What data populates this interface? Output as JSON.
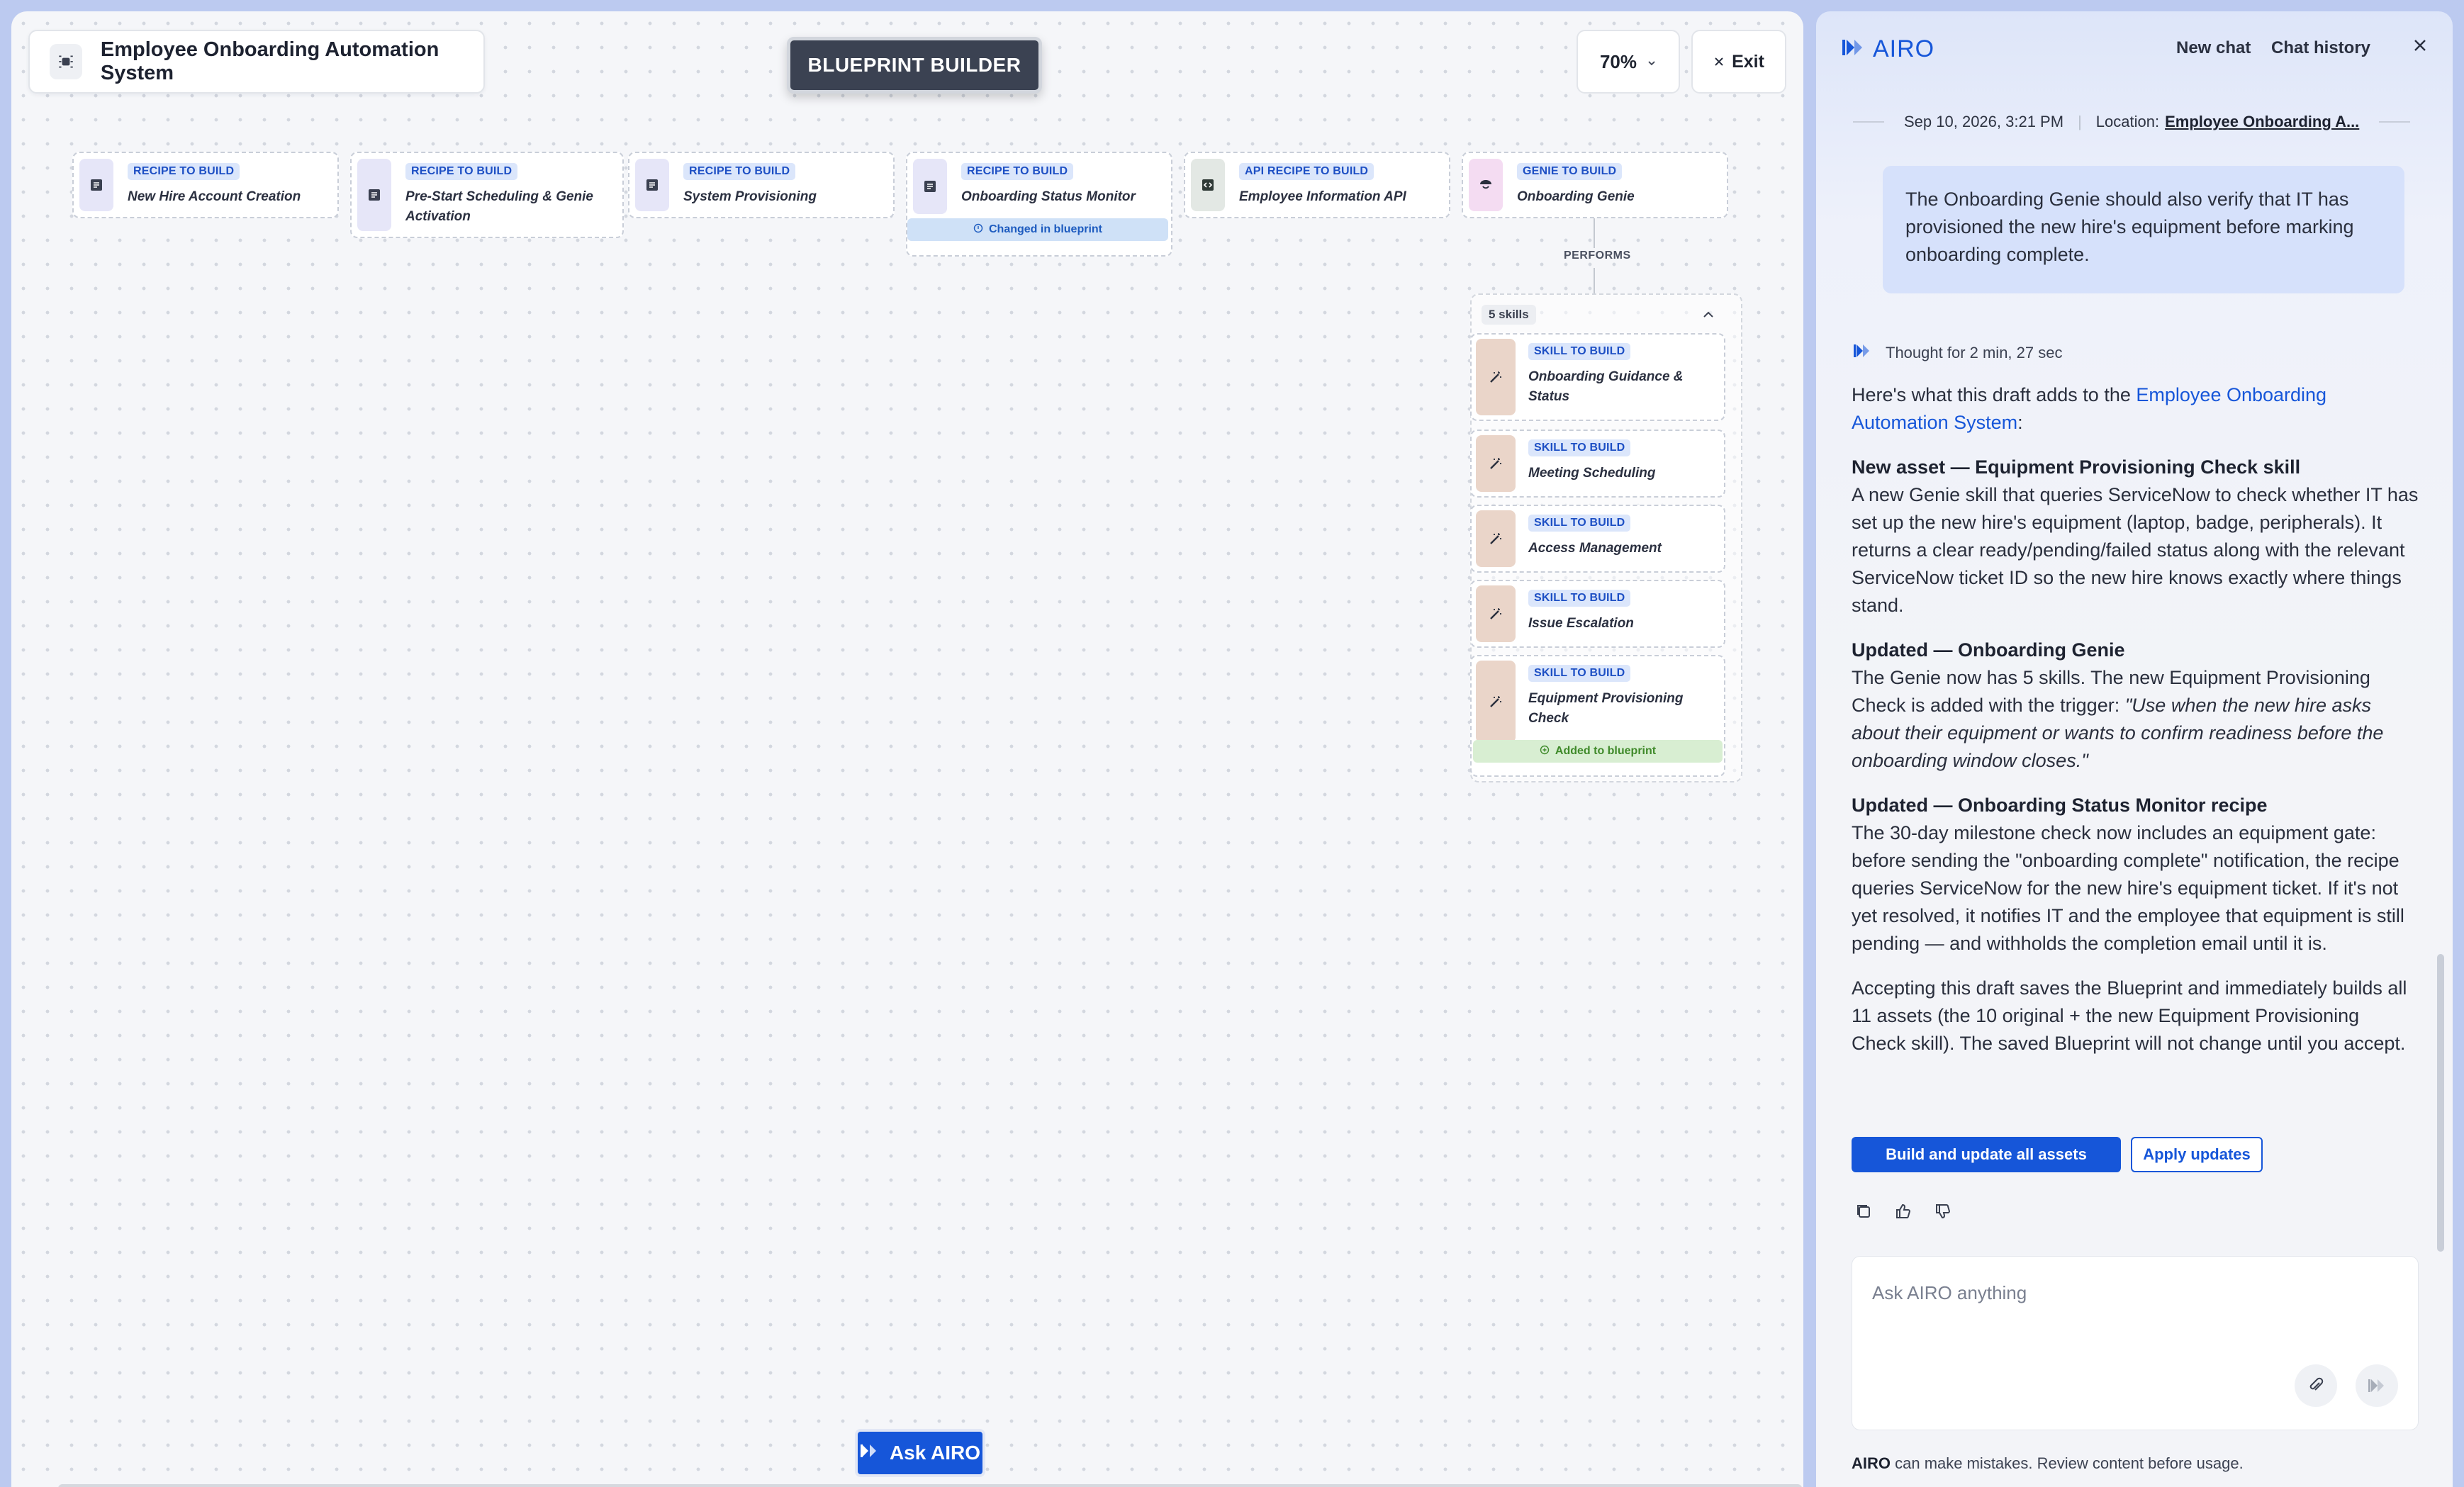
{
  "canvas": {
    "project_title": "Employee Onboarding Automation System",
    "mode_badge": "BLUEPRINT BUILDER",
    "zoom": "70%",
    "exit_label": "Exit",
    "nodes": [
      {
        "tag": "RECIPE TO BUILD",
        "name": "New Hire Account Creation",
        "icon": "document-icon"
      },
      {
        "tag": "RECIPE TO BUILD",
        "name": "Pre-Start Scheduling & Genie Activation",
        "icon": "document-icon"
      },
      {
        "tag": "RECIPE TO BUILD",
        "name": "System Provisioning",
        "icon": "document-icon"
      },
      {
        "tag": "RECIPE TO BUILD",
        "name": "Onboarding Status Monitor",
        "icon": "document-icon",
        "status": "Changed in blueprint"
      },
      {
        "tag": "API RECIPE TO BUILD",
        "name": "Employee Information API",
        "icon": "api-icon"
      },
      {
        "tag": "GENIE TO BUILD",
        "name": "Onboarding Genie",
        "icon": "genie-icon"
      }
    ],
    "performs_label": "PERFORMS",
    "skills_count": "5 skills",
    "skills": [
      {
        "tag": "SKILL TO BUILD",
        "name": "Onboarding Guidance & Status"
      },
      {
        "tag": "SKILL TO BUILD",
        "name": "Meeting Scheduling"
      },
      {
        "tag": "SKILL TO BUILD",
        "name": "Access Management"
      },
      {
        "tag": "SKILL TO BUILD",
        "name": "Issue Escalation"
      },
      {
        "tag": "SKILL TO BUILD",
        "name": "Equipment Provisioning Check",
        "status": "Added to blueprint"
      }
    ],
    "ask_button": "Ask AIRO"
  },
  "chat": {
    "brand": "AIRO",
    "new_chat": "New chat",
    "chat_history": "Chat history",
    "timestamp": "Sep 10, 2026, 3:21 PM",
    "location_label": "Location:",
    "location_value": "Employee Onboarding A...",
    "user_message": "The Onboarding Genie should also verify that IT has provisioned the new hire's equipment before marking onboarding complete.",
    "thought": "Thought for 2 min, 27 sec",
    "intro_prefix": "Here's what this draft adds to the",
    "intro_link": "Employee Onboarding Automation System",
    "intro_suffix": ":",
    "sec1_title": "New asset — Equipment Provisioning Check skill",
    "sec1_body": "A new Genie skill that queries ServiceNow to check whether IT has set up the new hire's equipment (laptop, badge, peripherals). It returns a clear ready/pending/failed status along with the relevant ServiceNow ticket ID so the new hire knows exactly where things stand.",
    "sec2_title": "Updated — Onboarding Genie",
    "sec2_body": "The Genie now has 5 skills. The new Equipment Provisioning Check is added with the trigger:",
    "sec2_quote": "\"Use when the new hire asks about their equipment or wants to confirm readiness before the onboarding window closes.\"",
    "sec3_title": "Updated — Onboarding Status Monitor recipe",
    "sec3_body": "The 30-day milestone check now includes an equipment gate: before sending the \"onboarding complete\" notification, the recipe queries ServiceNow for the new hire's equipment ticket. If it's not yet resolved, it notifies IT and the employee that equipment is still pending — and withholds the completion email until it is.",
    "closing": "Accepting this draft saves the Blueprint and immediately builds all 11 assets (the 10 original + the new Equipment Provisioning Check skill). The saved Blueprint will not change until you accept.",
    "primary_action": "Build and update all assets",
    "secondary_action": "Apply updates",
    "input_placeholder": "Ask AIRO anything",
    "disclaimer_brand": "AIRO",
    "disclaimer_text": " can make mistakes. Review content before usage."
  },
  "colors": {
    "accent": "#1656d9",
    "tag_bg": "#dbe6fb",
    "changed_bg": "#cfe1f7",
    "added_bg": "#d8eed2"
  }
}
